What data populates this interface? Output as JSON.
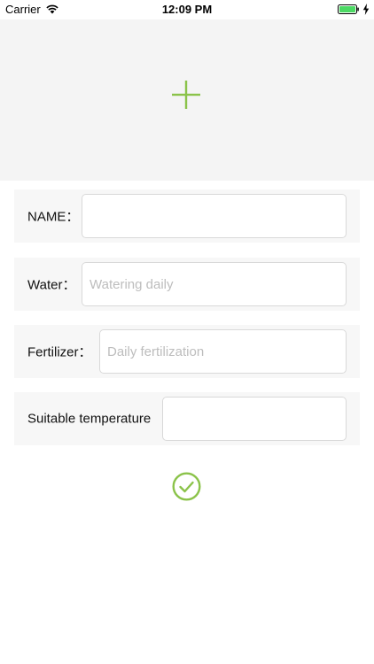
{
  "status_bar": {
    "carrier": "Carrier",
    "time": "12:09 PM",
    "battery_color": "#4cd964"
  },
  "image_picker": {
    "icon": "plus-icon",
    "accent_color": "#8bc34a"
  },
  "form": {
    "name": {
      "label": "NAME：",
      "value": "",
      "placeholder": ""
    },
    "water": {
      "label": "Water：",
      "value": "",
      "placeholder": "Watering daily"
    },
    "fertilizer": {
      "label": "Fertilizer：",
      "value": "",
      "placeholder": "Daily fertilization"
    },
    "temperature": {
      "label": "Suitable temperature",
      "value": "",
      "placeholder": ""
    }
  },
  "confirm": {
    "icon": "check-circle-icon",
    "accent_color": "#8bc34a"
  }
}
